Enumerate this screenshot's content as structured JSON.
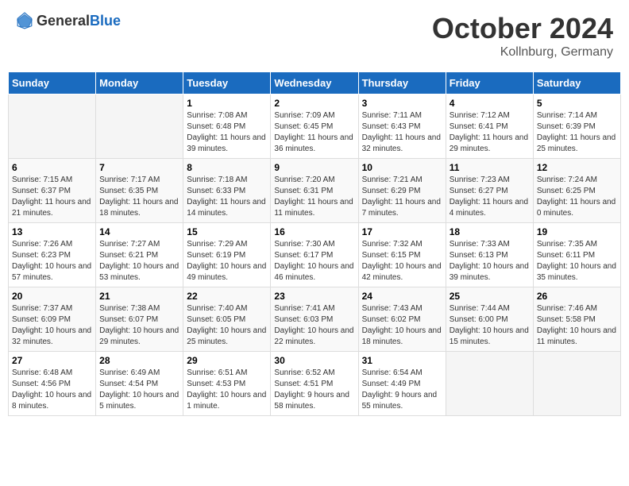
{
  "header": {
    "logo_general": "General",
    "logo_blue": "Blue",
    "month_title": "October 2024",
    "subtitle": "Kollnburg, Germany"
  },
  "weekdays": [
    "Sunday",
    "Monday",
    "Tuesday",
    "Wednesday",
    "Thursday",
    "Friday",
    "Saturday"
  ],
  "rows": [
    [
      {
        "day": "",
        "info": ""
      },
      {
        "day": "",
        "info": ""
      },
      {
        "day": "1",
        "info": "Sunrise: 7:08 AM\nSunset: 6:48 PM\nDaylight: 11 hours and 39 minutes."
      },
      {
        "day": "2",
        "info": "Sunrise: 7:09 AM\nSunset: 6:45 PM\nDaylight: 11 hours and 36 minutes."
      },
      {
        "day": "3",
        "info": "Sunrise: 7:11 AM\nSunset: 6:43 PM\nDaylight: 11 hours and 32 minutes."
      },
      {
        "day": "4",
        "info": "Sunrise: 7:12 AM\nSunset: 6:41 PM\nDaylight: 11 hours and 29 minutes."
      },
      {
        "day": "5",
        "info": "Sunrise: 7:14 AM\nSunset: 6:39 PM\nDaylight: 11 hours and 25 minutes."
      }
    ],
    [
      {
        "day": "6",
        "info": "Sunrise: 7:15 AM\nSunset: 6:37 PM\nDaylight: 11 hours and 21 minutes."
      },
      {
        "day": "7",
        "info": "Sunrise: 7:17 AM\nSunset: 6:35 PM\nDaylight: 11 hours and 18 minutes."
      },
      {
        "day": "8",
        "info": "Sunrise: 7:18 AM\nSunset: 6:33 PM\nDaylight: 11 hours and 14 minutes."
      },
      {
        "day": "9",
        "info": "Sunrise: 7:20 AM\nSunset: 6:31 PM\nDaylight: 11 hours and 11 minutes."
      },
      {
        "day": "10",
        "info": "Sunrise: 7:21 AM\nSunset: 6:29 PM\nDaylight: 11 hours and 7 minutes."
      },
      {
        "day": "11",
        "info": "Sunrise: 7:23 AM\nSunset: 6:27 PM\nDaylight: 11 hours and 4 minutes."
      },
      {
        "day": "12",
        "info": "Sunrise: 7:24 AM\nSunset: 6:25 PM\nDaylight: 11 hours and 0 minutes."
      }
    ],
    [
      {
        "day": "13",
        "info": "Sunrise: 7:26 AM\nSunset: 6:23 PM\nDaylight: 10 hours and 57 minutes."
      },
      {
        "day": "14",
        "info": "Sunrise: 7:27 AM\nSunset: 6:21 PM\nDaylight: 10 hours and 53 minutes."
      },
      {
        "day": "15",
        "info": "Sunrise: 7:29 AM\nSunset: 6:19 PM\nDaylight: 10 hours and 49 minutes."
      },
      {
        "day": "16",
        "info": "Sunrise: 7:30 AM\nSunset: 6:17 PM\nDaylight: 10 hours and 46 minutes."
      },
      {
        "day": "17",
        "info": "Sunrise: 7:32 AM\nSunset: 6:15 PM\nDaylight: 10 hours and 42 minutes."
      },
      {
        "day": "18",
        "info": "Sunrise: 7:33 AM\nSunset: 6:13 PM\nDaylight: 10 hours and 39 minutes."
      },
      {
        "day": "19",
        "info": "Sunrise: 7:35 AM\nSunset: 6:11 PM\nDaylight: 10 hours and 35 minutes."
      }
    ],
    [
      {
        "day": "20",
        "info": "Sunrise: 7:37 AM\nSunset: 6:09 PM\nDaylight: 10 hours and 32 minutes."
      },
      {
        "day": "21",
        "info": "Sunrise: 7:38 AM\nSunset: 6:07 PM\nDaylight: 10 hours and 29 minutes."
      },
      {
        "day": "22",
        "info": "Sunrise: 7:40 AM\nSunset: 6:05 PM\nDaylight: 10 hours and 25 minutes."
      },
      {
        "day": "23",
        "info": "Sunrise: 7:41 AM\nSunset: 6:03 PM\nDaylight: 10 hours and 22 minutes."
      },
      {
        "day": "24",
        "info": "Sunrise: 7:43 AM\nSunset: 6:02 PM\nDaylight: 10 hours and 18 minutes."
      },
      {
        "day": "25",
        "info": "Sunrise: 7:44 AM\nSunset: 6:00 PM\nDaylight: 10 hours and 15 minutes."
      },
      {
        "day": "26",
        "info": "Sunrise: 7:46 AM\nSunset: 5:58 PM\nDaylight: 10 hours and 11 minutes."
      }
    ],
    [
      {
        "day": "27",
        "info": "Sunrise: 6:48 AM\nSunset: 4:56 PM\nDaylight: 10 hours and 8 minutes."
      },
      {
        "day": "28",
        "info": "Sunrise: 6:49 AM\nSunset: 4:54 PM\nDaylight: 10 hours and 5 minutes."
      },
      {
        "day": "29",
        "info": "Sunrise: 6:51 AM\nSunset: 4:53 PM\nDaylight: 10 hours and 1 minute."
      },
      {
        "day": "30",
        "info": "Sunrise: 6:52 AM\nSunset: 4:51 PM\nDaylight: 9 hours and 58 minutes."
      },
      {
        "day": "31",
        "info": "Sunrise: 6:54 AM\nSunset: 4:49 PM\nDaylight: 9 hours and 55 minutes."
      },
      {
        "day": "",
        "info": ""
      },
      {
        "day": "",
        "info": ""
      }
    ]
  ]
}
